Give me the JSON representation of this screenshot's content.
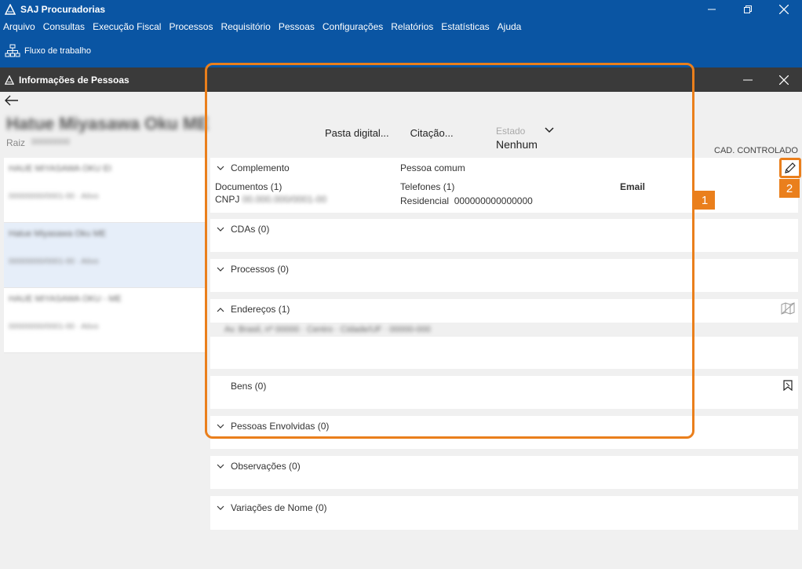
{
  "app": {
    "title": "SAJ Procuradorias",
    "menu": [
      "Arquivo",
      "Consultas",
      "Execução Fiscal",
      "Processos",
      "Requisitório",
      "Pessoas",
      "Configurações",
      "Relatórios",
      "Estatísticas",
      "Ajuda"
    ],
    "toolbar_item": "Fluxo de trabalho"
  },
  "window": {
    "title": "Informações de Pessoas"
  },
  "person": {
    "name": "Hatue Miyasawa Oku ME",
    "raiz_label": "Raiz",
    "raiz_value": "00000000"
  },
  "actions": {
    "pasta": "Pasta digital...",
    "citacao": "Citação..."
  },
  "estado": {
    "label": "Estado",
    "value": "Nenhum"
  },
  "cad_label": "CAD. CONTROLADO",
  "left_list": [
    {
      "name": "HAUE MIYASAWA OKU EI",
      "sub": "00000000/0001-00 · Ativo"
    },
    {
      "name": "Hatue Miyasawa Oku ME",
      "sub": "00000000/0001-00 · Ativo"
    },
    {
      "name": "HAUE MIYASAWA OKU - ME",
      "sub": "00000000/0001-00 · Ativo"
    }
  ],
  "complemento": {
    "title": "Complemento",
    "tipo": "Pessoa comum",
    "documentos_label": "Documentos (1)",
    "cnpj_label": "CNPJ",
    "cnpj_value": "00.000.000/0001-00",
    "telefones_label": "Telefones (1)",
    "tel_tipo": "Residencial",
    "tel_numero": "000000000000000",
    "email_label": "Email"
  },
  "sections": {
    "cdas": "CDAs (0)",
    "processos": "Processos (0)",
    "enderecos": "Endereços (1)",
    "endereco_value": "Av. Brasil, nº 00000 · Centro · Cidade/UF · 00000-000",
    "bens": "Bens (0)",
    "envolvidas": "Pessoas Envolvidas (0)",
    "observacoes": "Observações (0)",
    "variacoes": "Variações de Nome (0)"
  },
  "badges": {
    "one": "1",
    "two": "2"
  },
  "colors": {
    "brand_blue": "#0a55a3",
    "accent_orange": "#ea7f1c",
    "dark_bar": "#3a3a3a"
  },
  "icons": [
    "saj-logo-icon",
    "minimize-icon",
    "restore-icon",
    "close-icon",
    "org-chart-icon",
    "back-arrow-icon",
    "chevron-down-icon",
    "chevron-up-icon",
    "pencil-icon",
    "map-icon",
    "bookmark-icon"
  ]
}
